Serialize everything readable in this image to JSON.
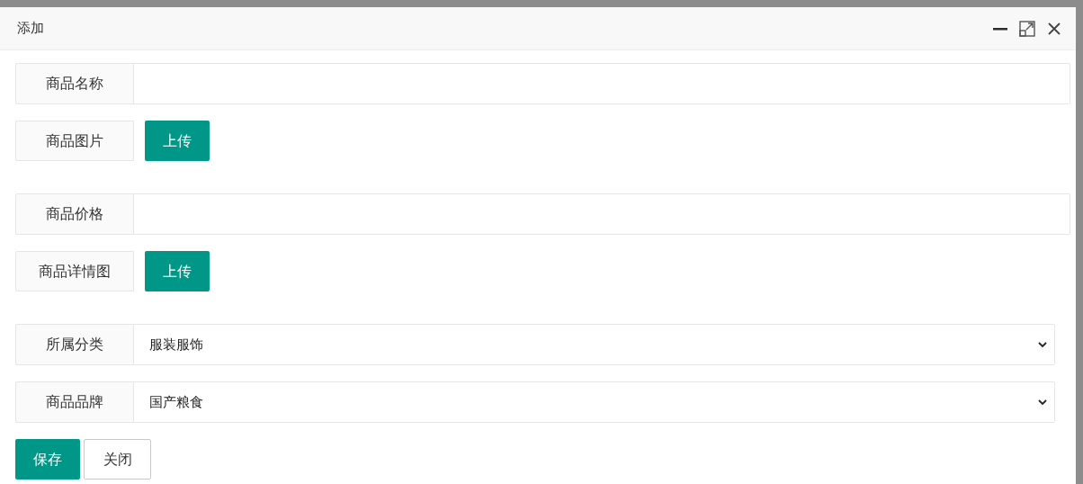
{
  "dialog": {
    "title": "添加"
  },
  "fields": [
    {
      "kind": "text",
      "label": "商品名称"
    },
    {
      "kind": "upload",
      "label": "商品图片",
      "button": "上传"
    },
    {
      "kind": "text",
      "label": "商品价格"
    },
    {
      "kind": "upload",
      "label": "商品详情图",
      "button": "上传"
    },
    {
      "kind": "select",
      "label": "所属分类",
      "value": "服装服饰"
    },
    {
      "kind": "select",
      "label": "商品品牌",
      "value": "国产粮食"
    }
  ],
  "buttons": [
    {
      "label": "保存",
      "kind": "primary"
    },
    {
      "label": "关闭",
      "kind": "plain"
    }
  ]
}
